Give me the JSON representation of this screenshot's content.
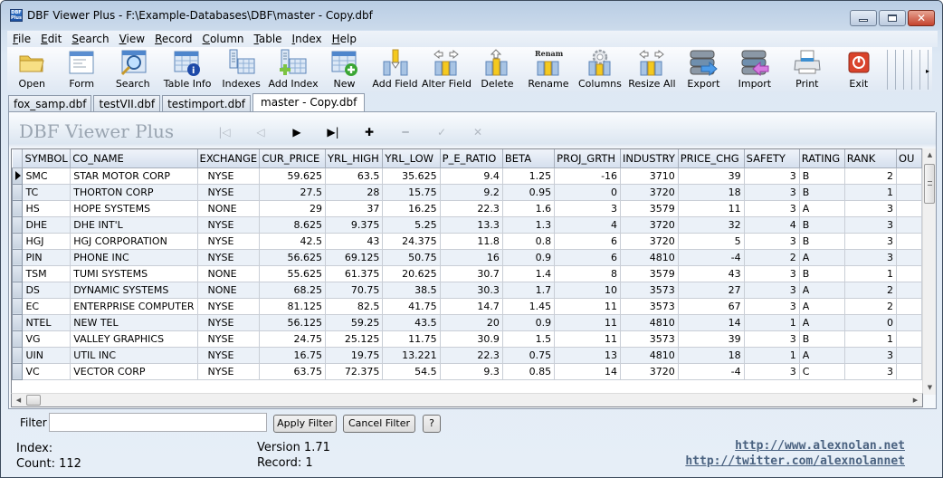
{
  "window": {
    "title": "DBF Viewer Plus - F:\\Example-Databases\\DBF\\master - Copy.dbf",
    "app_icon_text": "DBF Plus",
    "controls": {
      "minimize": "minimize",
      "maximize": "maximize",
      "close": "✕"
    }
  },
  "menu": [
    "File",
    "Edit",
    "Search",
    "View",
    "Record",
    "Column",
    "Table",
    "Index",
    "Help"
  ],
  "toolbar": [
    {
      "label": "Open",
      "icon": "folder-icon"
    },
    {
      "label": "Form",
      "icon": "form-icon"
    },
    {
      "sep": true
    },
    {
      "label": "Search",
      "icon": "search-icon"
    },
    {
      "sep": true
    },
    {
      "label": "Table Info",
      "icon": "table-info-icon"
    },
    {
      "label": "Indexes",
      "icon": "indexes-icon"
    },
    {
      "label": "Add Index",
      "icon": "add-index-icon"
    },
    {
      "sep": true
    },
    {
      "label": "New",
      "icon": "new-record-icon"
    },
    {
      "label": "Add Field",
      "icon": "add-field-icon"
    },
    {
      "label": "Alter Field",
      "icon": "alter-field-icon"
    },
    {
      "label": "Delete",
      "icon": "delete-field-icon"
    },
    {
      "label": "Rename",
      "icon": "rename-field-icon",
      "icon_text": "Rename"
    },
    {
      "sep": true
    },
    {
      "label": "Columns",
      "icon": "columns-icon"
    },
    {
      "label": "Resize All",
      "icon": "resize-all-icon"
    },
    {
      "sep": true
    },
    {
      "label": "Export",
      "icon": "export-icon"
    },
    {
      "label": "Import",
      "icon": "import-icon"
    },
    {
      "sep": true
    },
    {
      "label": "Print",
      "icon": "printer-icon"
    },
    {
      "label": "Exit",
      "icon": "exit-icon"
    }
  ],
  "toolbar_overflow": "▸",
  "tabs": [
    {
      "label": "fox_samp.dbf",
      "active": false
    },
    {
      "label": "testVII.dbf",
      "active": false
    },
    {
      "label": "testimport.dbf",
      "active": false
    },
    {
      "label": "master - Copy.dbf",
      "active": true
    }
  ],
  "brand": "DBF Viewer Plus",
  "nav": [
    {
      "name": "first-record",
      "glyph": "|◁",
      "enabled": false
    },
    {
      "name": "prior-record",
      "glyph": "◁",
      "enabled": false
    },
    {
      "name": "next-record",
      "glyph": "▶",
      "enabled": true
    },
    {
      "name": "last-record",
      "glyph": "▶|",
      "enabled": true
    },
    {
      "name": "insert-record",
      "glyph": "✚",
      "enabled": true
    },
    {
      "name": "delete-record",
      "glyph": "━",
      "enabled": false
    },
    {
      "name": "post-edit",
      "glyph": "✓",
      "enabled": false
    },
    {
      "name": "cancel-edit",
      "glyph": "✕",
      "enabled": false
    }
  ],
  "grid": {
    "columns": [
      "SYMBOL",
      "CO_NAME",
      "EXCHANGE",
      "CUR_PRICE",
      "YRL_HIGH",
      "YRL_LOW",
      "P_E_RATIO",
      "BETA",
      "PROJ_GRTH",
      "INDUSTRY",
      "PRICE_CHG",
      "SAFETY",
      "RATING",
      "RANK",
      "OU"
    ],
    "current_row": 0,
    "rows": [
      [
        "SMC",
        "STAR MOTOR CORP",
        "NYSE",
        "59.625",
        "63.5",
        "35.625",
        "9.4",
        "1.25",
        "-16",
        "3710",
        "39",
        "3",
        "B",
        "2",
        ""
      ],
      [
        "TC",
        "THORTON CORP",
        "NYSE",
        "27.5",
        "28",
        "15.75",
        "9.2",
        "0.95",
        "0",
        "3720",
        "18",
        "3",
        "B",
        "1",
        ""
      ],
      [
        "HS",
        "HOPE SYSTEMS",
        "NONE",
        "29",
        "37",
        "16.25",
        "22.3",
        "1.6",
        "3",
        "3579",
        "11",
        "3",
        "A",
        "3",
        ""
      ],
      [
        "DHE",
        "DHE INT'L",
        "NYSE",
        "8.625",
        "9.375",
        "5.25",
        "13.3",
        "1.3",
        "4",
        "3720",
        "32",
        "4",
        "B",
        "3",
        ""
      ],
      [
        "HGJ",
        "HGJ CORPORATION",
        "NYSE",
        "42.5",
        "43",
        "24.375",
        "11.8",
        "0.8",
        "6",
        "3720",
        "5",
        "3",
        "B",
        "3",
        ""
      ],
      [
        "PIN",
        "PHONE INC",
        "NYSE",
        "56.625",
        "69.125",
        "50.75",
        "16",
        "0.9",
        "6",
        "4810",
        "-4",
        "2",
        "A",
        "3",
        ""
      ],
      [
        "TSM",
        "TUMI SYSTEMS",
        "NONE",
        "55.625",
        "61.375",
        "20.625",
        "30.7",
        "1.4",
        "8",
        "3579",
        "43",
        "3",
        "B",
        "1",
        ""
      ],
      [
        "DS",
        "DYNAMIC SYSTEMS",
        "NONE",
        "68.25",
        "70.75",
        "38.5",
        "30.3",
        "1.7",
        "10",
        "3573",
        "27",
        "3",
        "A",
        "2",
        ""
      ],
      [
        "EC",
        "ENTERPRISE COMPUTER",
        "NYSE",
        "81.125",
        "82.5",
        "41.75",
        "14.7",
        "1.45",
        "11",
        "3573",
        "67",
        "3",
        "A",
        "2",
        ""
      ],
      [
        "NTEL",
        "NEW TEL",
        "NYSE",
        "56.125",
        "59.25",
        "43.5",
        "20",
        "0.9",
        "11",
        "4810",
        "14",
        "1",
        "A",
        "0",
        ""
      ],
      [
        "VG",
        "VALLEY GRAPHICS",
        "NYSE",
        "24.75",
        "25.125",
        "11.75",
        "30.9",
        "1.5",
        "11",
        "3573",
        "39",
        "3",
        "B",
        "1",
        ""
      ],
      [
        "UIN",
        "UTIL INC",
        "NYSE",
        "16.75",
        "19.75",
        "13.221",
        "22.3",
        "0.75",
        "13",
        "4810",
        "18",
        "1",
        "A",
        "3",
        ""
      ],
      [
        "VC",
        "VECTOR CORP",
        "NYSE",
        "63.75",
        "72.375",
        "54.5",
        "9.3",
        "0.85",
        "14",
        "3720",
        "-4",
        "3",
        "C",
        "3",
        ""
      ]
    ]
  },
  "filter": {
    "label": "Filter",
    "value": "",
    "apply_label": "Apply Filter",
    "cancel_label": "Cancel Filter",
    "help_label": "?"
  },
  "status": {
    "index": "Index:",
    "count": "Count: 112",
    "version": "Version 1.71",
    "record": "Record: 1",
    "link_site": "http://www.alexnolan.net",
    "link_twitter": "http://twitter.com/alexnolannet"
  }
}
